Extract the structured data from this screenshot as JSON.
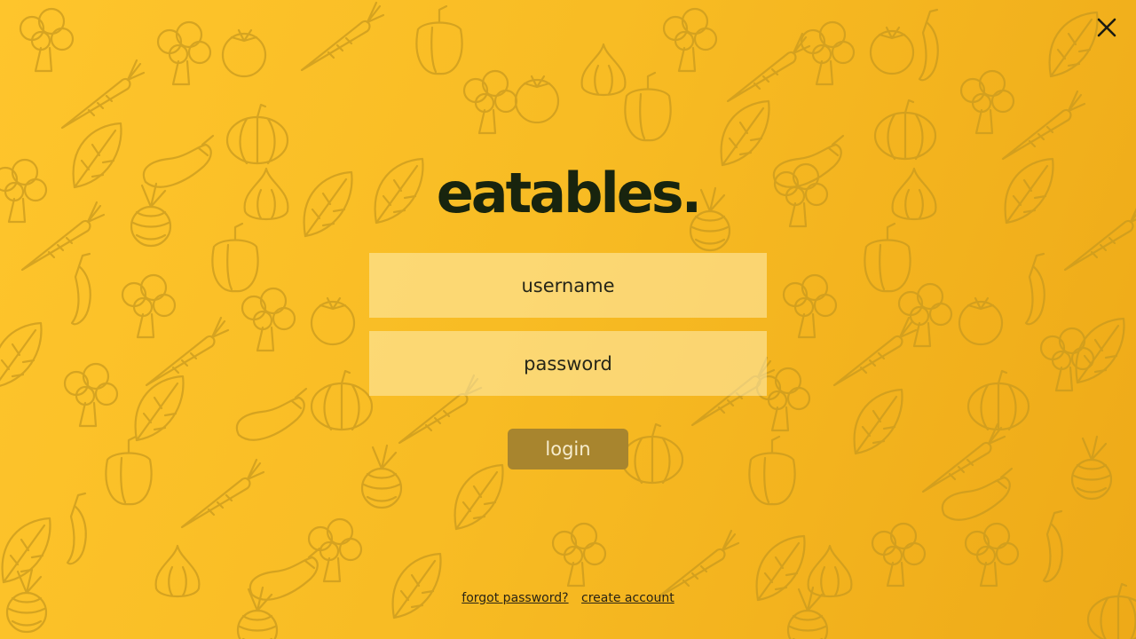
{
  "brand": {
    "logo_text": "eatables."
  },
  "form": {
    "username_placeholder": "username",
    "password_placeholder": "password",
    "login_label": "login"
  },
  "footer": {
    "forgot_password_label": "forgot password?",
    "create_account_label": "create account"
  },
  "icons": {
    "close": "close-icon"
  },
  "colors": {
    "background_start": "#fec52c",
    "background_end": "#eeaa18",
    "logo": "#18240e",
    "login_button": "#a8852e"
  }
}
